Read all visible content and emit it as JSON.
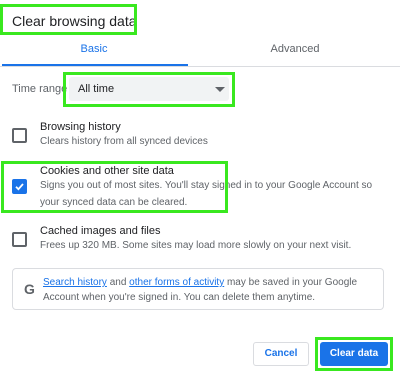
{
  "dialog": {
    "title": "Clear browsing data"
  },
  "tabs": [
    {
      "label": "Basic",
      "selected": true
    },
    {
      "label": "Advanced",
      "selected": false
    }
  ],
  "time_range": {
    "label": "Time range",
    "value": "All time"
  },
  "options": [
    {
      "title": "Browsing history",
      "description": "Clears history from all synced devices",
      "checked": false
    },
    {
      "title": "Cookies and other site data",
      "description": "Signs you out of most sites. You'll stay signed in to your Google Account so your synced data can be cleared.",
      "checked": true
    },
    {
      "title": "Cached images and files",
      "description": "Frees up 320 MB. Some sites may load more slowly on your next visit.",
      "checked": false
    }
  ],
  "info": {
    "icon": "google-g-icon",
    "link1": "Search history",
    "middle": " and ",
    "link2": "other forms of activity",
    "rest": " may be saved in your Google Account when you're signed in. You can delete them anytime."
  },
  "buttons": {
    "cancel": "Cancel",
    "clear": "Clear data"
  },
  "colors": {
    "accent": "#1a73e8",
    "highlight": "#39e81f"
  }
}
